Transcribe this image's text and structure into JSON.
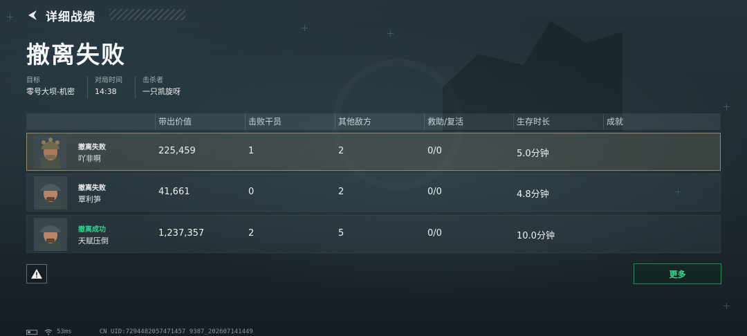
{
  "header": {
    "title": "详细战绩"
  },
  "result": {
    "title": "撤离失败"
  },
  "info": [
    {
      "label": "目标",
      "value": "零号大坝-机密"
    },
    {
      "label": "对局时间",
      "value": "14:38"
    },
    {
      "label": "击杀者",
      "value": "一只凯旋呀"
    }
  ],
  "table": {
    "headers": [
      "带出价值",
      "击败干员",
      "其他敌方",
      "救助/复活",
      "生存时长",
      "成就"
    ],
    "rows": [
      {
        "status": "撤离失败",
        "name": "吖非啊",
        "value": "225,459",
        "kills": "1",
        "other": "2",
        "revive": "0/0",
        "time": "5.0分钟",
        "achievement": ""
      },
      {
        "status": "撤离失败",
        "name": "覃利笋",
        "value": "41,661",
        "kills": "0",
        "other": "2",
        "revive": "0/0",
        "time": "4.8分钟",
        "achievement": ""
      },
      {
        "status": "撤离成功",
        "name": "天赋压倒",
        "value": "1,237,357",
        "kills": "2",
        "other": "5",
        "revive": "0/0",
        "time": "10.0分钟",
        "achievement": ""
      }
    ]
  },
  "buttons": {
    "more_label": "更多"
  },
  "footer": {
    "ping": "53ms",
    "uid": "CN UID:7294482057471457 9387_202607141449"
  },
  "colors": {
    "success": "#2fd38c",
    "accent_green": "#39d98f",
    "highlight_border": "#8f8a6a"
  },
  "icons": {
    "back": "back-chevron-icon",
    "warning": "warning-triangle-icon",
    "battery": "battery-icon",
    "wifi": "wifi-icon"
  }
}
